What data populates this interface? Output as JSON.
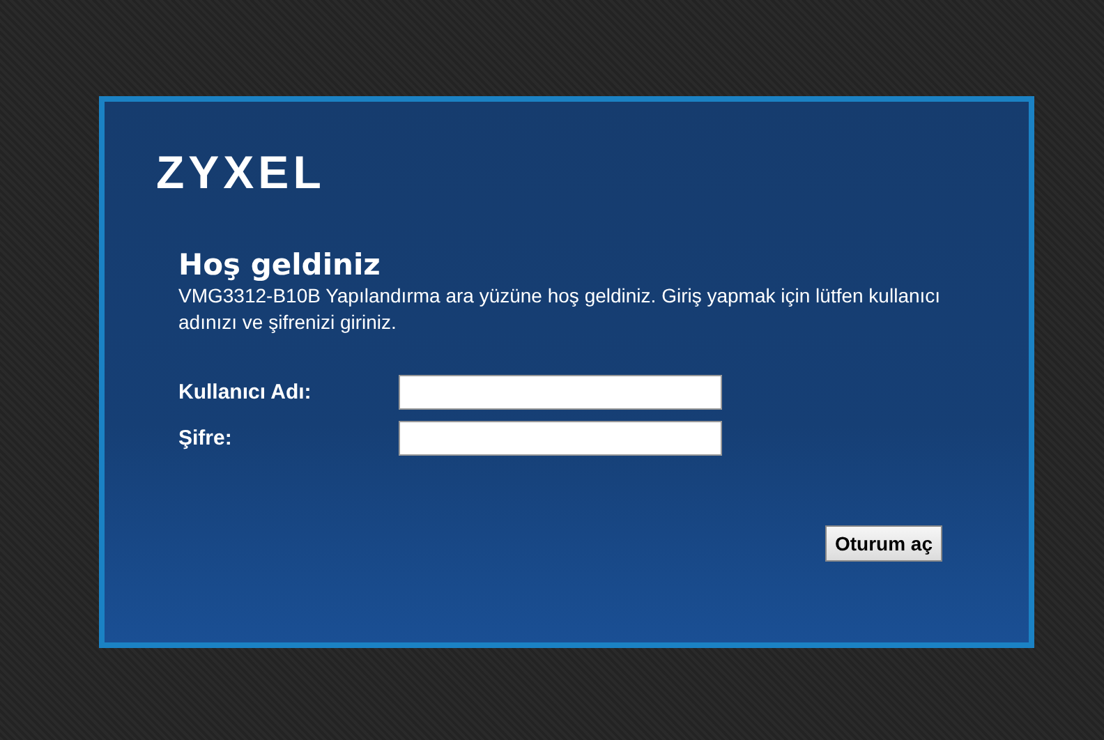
{
  "logo": "ZYXEL",
  "title": "Hoş geldiniz",
  "description": "VMG3312-B10B Yapılandırma ara yüzüne hoş geldiniz. Giriş yapmak için lütfen kullanıcı adınızı ve şifrenizi giriniz.",
  "fields": [
    {
      "label": "Kullanıcı Adı:"
    },
    {
      "label": "Şifre:"
    }
  ],
  "login_button": "Oturum aç"
}
